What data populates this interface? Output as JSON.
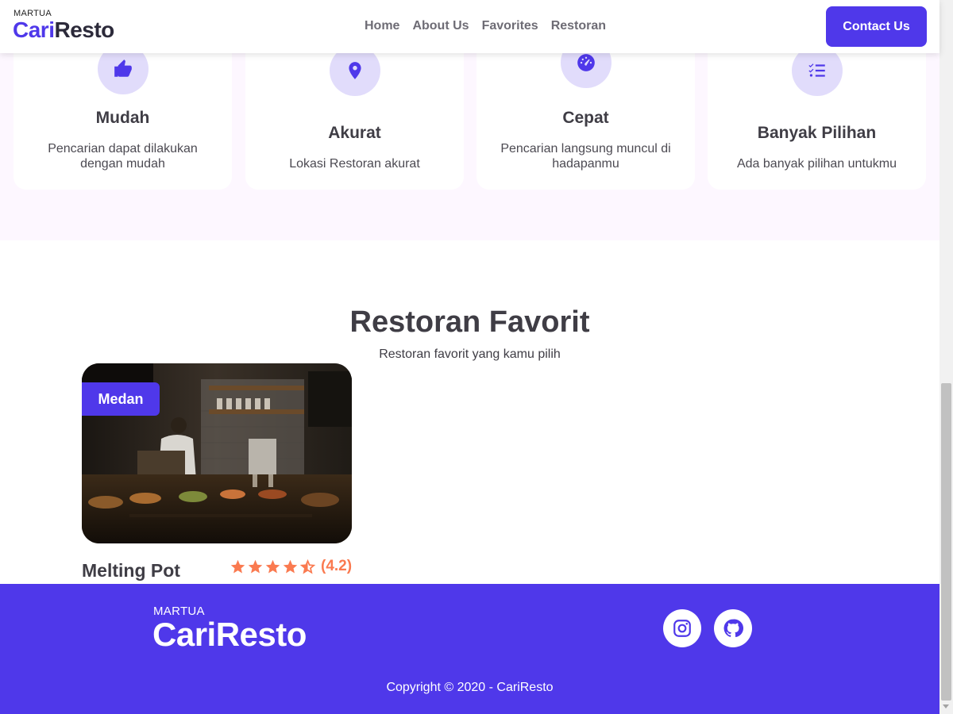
{
  "navbar": {
    "brand_small": "MARTUA",
    "brand_cari": "Cari",
    "brand_resto": "Resto",
    "links": [
      "Home",
      "About Us",
      "Favorites",
      "Restoran"
    ],
    "contact_label": "Contact Us"
  },
  "features": [
    {
      "icon": "thumbs-up-icon",
      "title": "Mudah",
      "desc": "Pencarian dapat dilakukan dengan mudah"
    },
    {
      "icon": "location-pin-icon",
      "title": "Akurat",
      "desc": "Lokasi Restoran akurat"
    },
    {
      "icon": "speedometer-icon",
      "title": "Cepat",
      "desc": "Pencarian langsung muncul di hadapanmu"
    },
    {
      "icon": "checklist-icon",
      "title": "Banyak Pilihan",
      "desc": "Ada banyak pilihan untukmu"
    }
  ],
  "favorites": {
    "title": "Restoran Favorit",
    "subtitle": "Restoran favorit yang kamu pilih",
    "items": [
      {
        "city": "Medan",
        "name": "Melting Pot",
        "rating": 4.2,
        "rating_text": "(4.2)"
      }
    ]
  },
  "footer": {
    "brand_small": "MARTUA",
    "brand_main": "CariResto",
    "socials": [
      "instagram-icon",
      "github-icon"
    ],
    "copyright": "Copyright © 2020 - CariResto"
  },
  "colors": {
    "primary": "#4f38ea",
    "accent_star": "#fa7a50",
    "icon_bg": "#e1dcfb",
    "section_bg": "#fdf7ff"
  }
}
